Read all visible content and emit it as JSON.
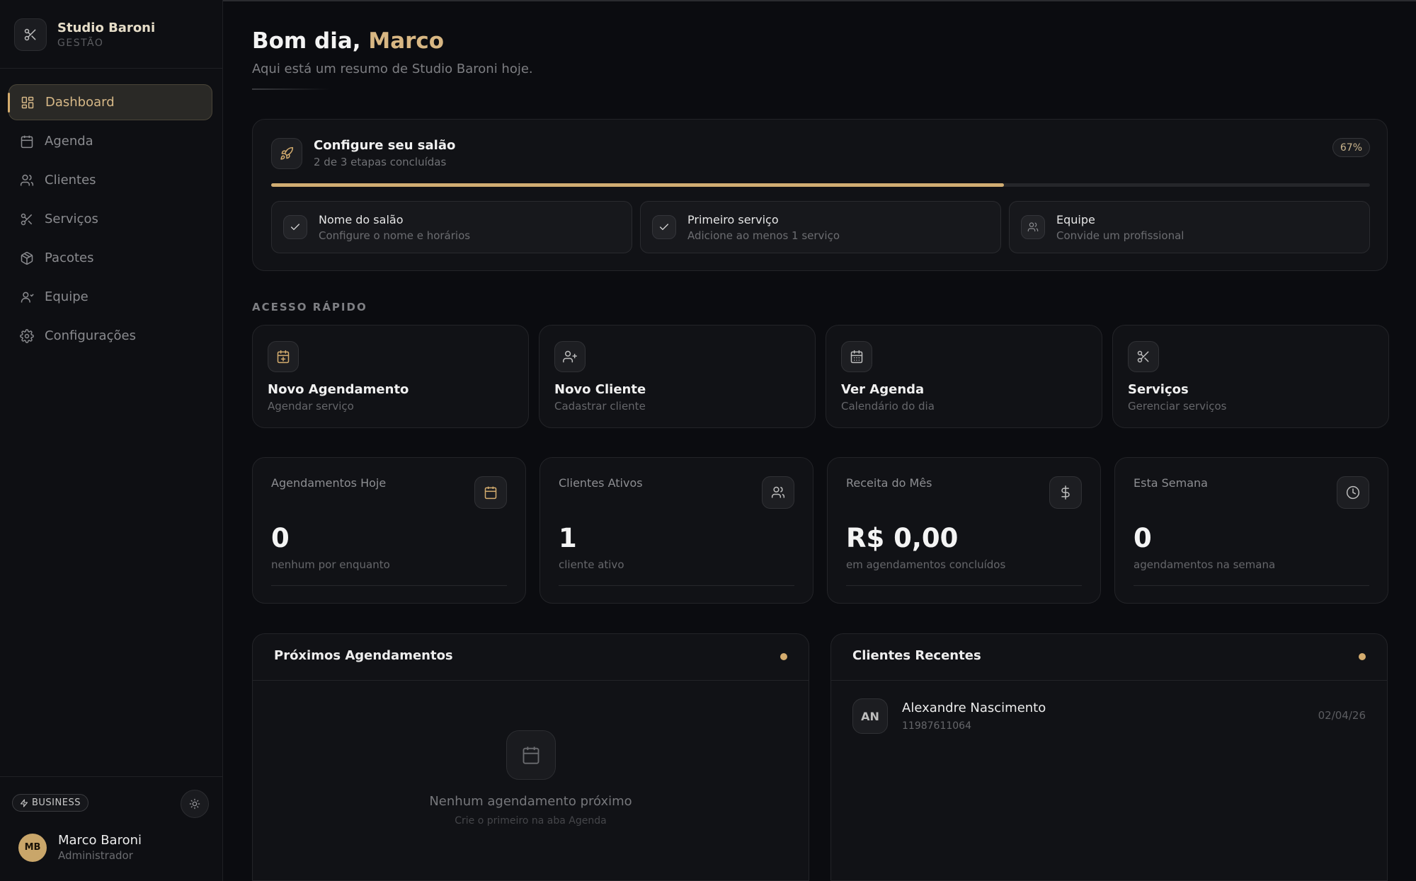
{
  "brand": {
    "name": "Studio Baroni",
    "subtitle": "GESTÃO",
    "icon": "scissors-icon"
  },
  "nav": [
    {
      "label": "Dashboard",
      "icon": "grid-icon",
      "active": true
    },
    {
      "label": "Agenda",
      "icon": "calendar-icon",
      "active": false
    },
    {
      "label": "Clientes",
      "icon": "users-icon",
      "active": false
    },
    {
      "label": "Serviços",
      "icon": "scissors-icon",
      "active": false
    },
    {
      "label": "Pacotes",
      "icon": "package-icon",
      "active": false
    },
    {
      "label": "Equipe",
      "icon": "user-icon",
      "active": false
    },
    {
      "label": "Configurações",
      "icon": "gear-icon",
      "active": false
    }
  ],
  "plan": {
    "label": "BUSINESS",
    "icon": "bolt-icon"
  },
  "user": {
    "initials": "MB",
    "name": "Marco Baroni",
    "role": "Administrador"
  },
  "greeting": {
    "prefix": "Bom dia,",
    "name": "Marco",
    "subtitle": "Aqui está um resumo de Studio Baroni hoje."
  },
  "setup": {
    "title": "Configure seu salão",
    "subtitle": "2 de 3 etapas concluídas",
    "percent_label": "67%",
    "progress_fraction": 0.667,
    "steps": [
      {
        "title": "Nome do salão",
        "subtitle": "Configure o nome e horários",
        "done": true
      },
      {
        "title": "Primeiro serviço",
        "subtitle": "Adicione ao menos 1 serviço",
        "done": true
      },
      {
        "title": "Equipe",
        "subtitle": "Convide um profissional",
        "done": false
      }
    ]
  },
  "quick_access": {
    "label": "ACESSO RÁPIDO",
    "items": [
      {
        "title": "Novo Agendamento",
        "subtitle": "Agendar serviço",
        "icon": "calendar-plus-icon"
      },
      {
        "title": "Novo Cliente",
        "subtitle": "Cadastrar cliente",
        "icon": "user-plus-icon"
      },
      {
        "title": "Ver Agenda",
        "subtitle": "Calendário do dia",
        "icon": "calendar-grid-icon"
      },
      {
        "title": "Serviços",
        "subtitle": "Gerenciar serviços",
        "icon": "scissors-icon"
      }
    ]
  },
  "stats": [
    {
      "label": "Agendamentos Hoje",
      "value": "0",
      "subtitle": "nenhum por enquanto",
      "icon": "calendar-icon"
    },
    {
      "label": "Clientes Ativos",
      "value": "1",
      "subtitle": "cliente ativo",
      "icon": "users-icon"
    },
    {
      "label": "Receita do Mês",
      "value": "R$ 0,00",
      "subtitle": "em agendamentos concluídos",
      "icon": "dollar-icon"
    },
    {
      "label": "Esta Semana",
      "value": "0",
      "subtitle": "agendamentos na semana",
      "icon": "clock-icon"
    }
  ],
  "upcoming": {
    "title": "Próximos Agendamentos",
    "empty_title": "Nenhum agendamento próximo",
    "empty_subtitle": "Crie o primeiro na aba Agenda"
  },
  "recent_clients": {
    "title": "Clientes Recentes",
    "items": [
      {
        "initials": "AN",
        "name": "Alexandre Nascimento",
        "phone": "11987611064",
        "date": "02/04/26"
      }
    ]
  },
  "colors": {
    "accent": "#d4ac6e",
    "background": "#0b0c10",
    "card": "#111216"
  }
}
